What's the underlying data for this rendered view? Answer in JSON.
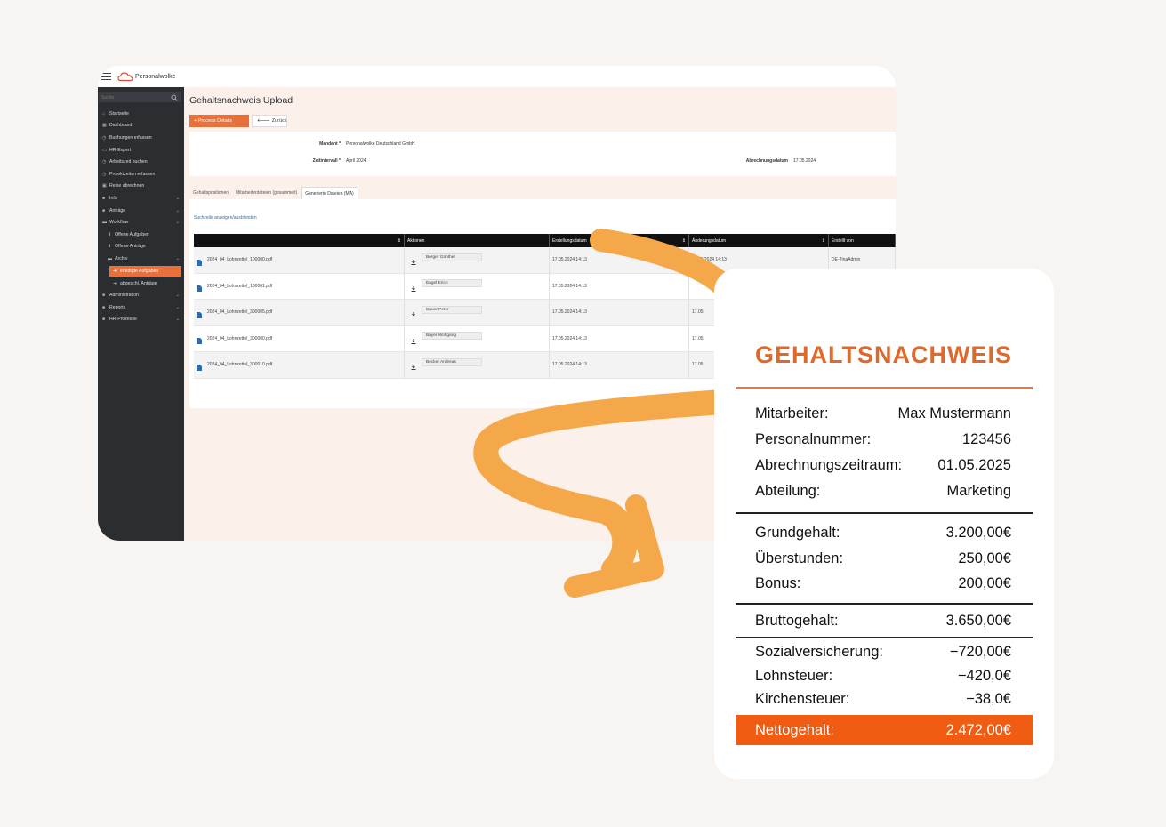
{
  "app": {
    "brand": "Personalwolke",
    "search_placeholder": "Suche",
    "sidebar": [
      {
        "label": "Startseite",
        "icon": "home-icon",
        "level": 0
      },
      {
        "label": "Dashboard",
        "icon": "dashboard-icon",
        "level": 0
      },
      {
        "label": "Buchungen erfassen",
        "icon": "clock-icon",
        "level": 0
      },
      {
        "label": "HR-Expert",
        "icon": "monitor-icon",
        "level": 0
      },
      {
        "label": "Arbeitszeit buchen",
        "icon": "clock-icon",
        "level": 0
      },
      {
        "label": "Projektzeiten erfassen",
        "icon": "clock-icon",
        "level": 0
      },
      {
        "label": "Reise abrechnen",
        "icon": "suitcase-icon",
        "level": 0
      },
      {
        "label": "Info",
        "icon": "folder-icon",
        "level": 0,
        "caret": true
      },
      {
        "label": "Anträge",
        "icon": "folder-icon",
        "level": 0,
        "caret": true
      },
      {
        "label": "Workflow",
        "icon": "folder-open-icon",
        "level": 0,
        "caret": true
      },
      {
        "label": "Offene Aufgaben",
        "icon": "download-icon",
        "level": 1
      },
      {
        "label": "Offene Anträge",
        "icon": "download-icon",
        "level": 1
      },
      {
        "label": "Archiv",
        "icon": "folder-open-icon",
        "level": 1,
        "caret": true
      },
      {
        "label": "erledigte Aufgaben",
        "icon": "arrow-right-icon",
        "level": 2,
        "active": true
      },
      {
        "label": "abgeschl. Anträge",
        "icon": "arrow-right-icon",
        "level": 2
      },
      {
        "label": "Administration",
        "icon": "folder-icon",
        "level": 0,
        "caret": true
      },
      {
        "label": "Reports",
        "icon": "folder-icon",
        "level": 0,
        "caret": true
      },
      {
        "label": "HR-Prozesse",
        "icon": "folder-icon",
        "level": 0,
        "caret": true
      }
    ],
    "page_title": "Gehaltsnachweis Upload",
    "process_button": "+ Process Details",
    "back_button": "Zurück",
    "mandant_label": "Mandant *",
    "mandant_value": "Personalwolke Deutschland GmbH",
    "zeitintervall_label": "Zeitintervall *",
    "zeitintervall_value": "April 2024",
    "abrechnungsdatum_label": "Abrechnungsdatum",
    "abrechnungsdatum_value": "17.05.2024",
    "tabs": [
      "Gehaltspositionen",
      "Mitarbeiterdateien (gesammelt)",
      "Generierte Dateien (MA)"
    ],
    "toggle_search": "Suchzeile anzeigen/ausblenden",
    "columns": [
      "",
      "Aktionen",
      "Erstellungsdatum",
      "Änderungsdatum",
      "Erstellt von"
    ],
    "rows": [
      {
        "file": "2024_04_Lohnzettel_100000.pdf",
        "person": "Berger Günther",
        "created": "17.05.2024 14:13",
        "changed": "17.05.2024 14:13",
        "by": "DE-TinaAdmin"
      },
      {
        "file": "2024_04_Lohnzettel_100001.pdf",
        "person": "Engel Erich",
        "created": "17.05.2024 14:13",
        "changed": "",
        "by": ""
      },
      {
        "file": "2024_04_Lohnzettel_300005.pdf",
        "person": "Bauer Peter",
        "created": "17.05.2024 14:13",
        "changed": "17.05.",
        "by": ""
      },
      {
        "file": "2024_04_Lohnzettel_300000.pdf",
        "person": "Bayer Wolfgang",
        "created": "17.05.2024 14:13",
        "changed": "17.05.",
        "by": ""
      },
      {
        "file": "2024_04_Lohnzettel_300010.pdf",
        "person": "Becker Andreas",
        "created": "17.05.2024 14:13",
        "changed": "17.05.",
        "by": ""
      }
    ]
  },
  "payslip": {
    "title": "GEHALTSNACHWEIS",
    "info": [
      {
        "label": "Mitarbeiter:",
        "value": "Max Mustermann"
      },
      {
        "label": "Personalnummer:",
        "value": "123456"
      },
      {
        "label": "Abrechnungszeitraum:",
        "value": "01.05.2025"
      },
      {
        "label": "Abteilung:",
        "value": "Marketing"
      }
    ],
    "earnings": [
      {
        "label": "Grundgehalt:",
        "value": "3.200,00€"
      },
      {
        "label": "Überstunden:",
        "value": "250,00€"
      },
      {
        "label": "Bonus:",
        "value": "200,00€"
      }
    ],
    "gross": {
      "label": "Bruttogehalt:",
      "value": "3.650,00€"
    },
    "deductions": [
      {
        "label": "Sozialversicherung:",
        "value": "−720,00€"
      },
      {
        "label": "Lohnsteuer:",
        "value": "−420,0€"
      },
      {
        "label": "Kirchensteuer:",
        "value": "−38,0€"
      }
    ],
    "net": {
      "label": "Nettogehalt:",
      "value": "2.472,00€"
    }
  },
  "colors": {
    "accent": "#e8703a",
    "net_bar": "#ef5c12",
    "arrow": "#f5a84a",
    "sidebar": "#2b2e31"
  }
}
